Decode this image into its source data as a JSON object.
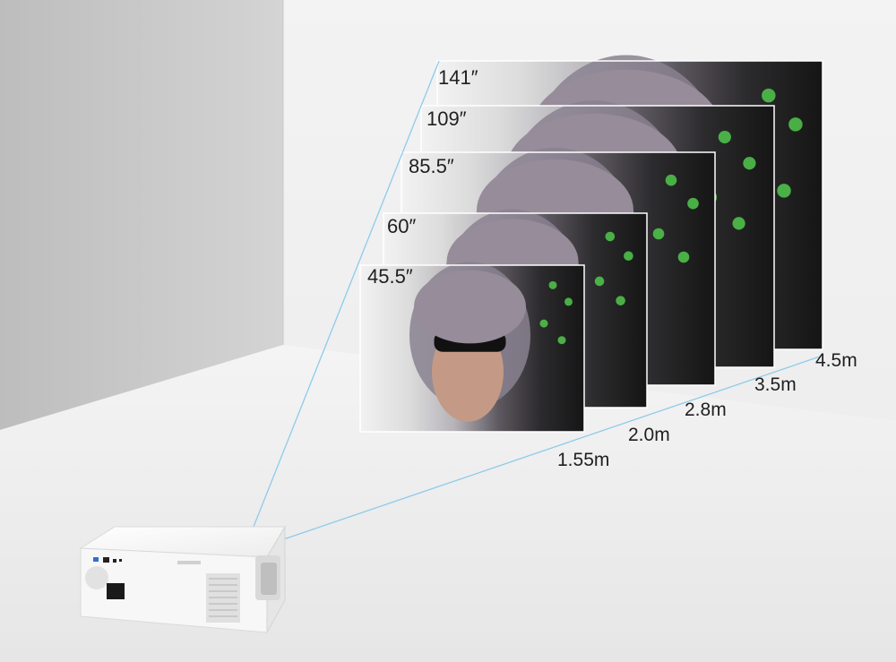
{
  "screen_sizes": [
    "141″",
    "109″",
    "85.5″",
    "60″",
    "45.5″"
  ],
  "distances": [
    "4.5m",
    "3.5m",
    "2.8m",
    "2.0m",
    "1.55m"
  ]
}
